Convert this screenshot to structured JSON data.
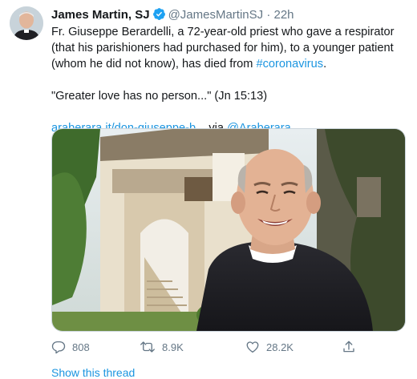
{
  "tweet": {
    "author_name": "James Martin, SJ",
    "handle": "@JamesMartinSJ",
    "separator": "·",
    "time": "22h",
    "text_before_link": "Fr. Giuseppe Berardelli, a 72-year-old priest who gave a respirator (that his parishioners had purchased for him), to a younger patient (whom he did not know), has died from ",
    "hashtag": "#coronavirus",
    "text_after_link": ".",
    "quote": "\"Greater love has no person...\" (Jn 15:13)",
    "link": "araberara.it/don-giuseppe-b...",
    "via_text": "via",
    "via_mention": "@Araberara"
  },
  "actions": {
    "reply_count": "808",
    "retweet_count": "8.9K",
    "like_count": "28.2K"
  },
  "footer": {
    "show_thread": "Show this thread"
  },
  "icons": [
    "verified-badge-icon",
    "reply-icon",
    "retweet-icon",
    "like-icon",
    "share-icon"
  ],
  "colors": {
    "accent": "#1b95e0",
    "muted": "#657786",
    "text": "#14171a"
  }
}
